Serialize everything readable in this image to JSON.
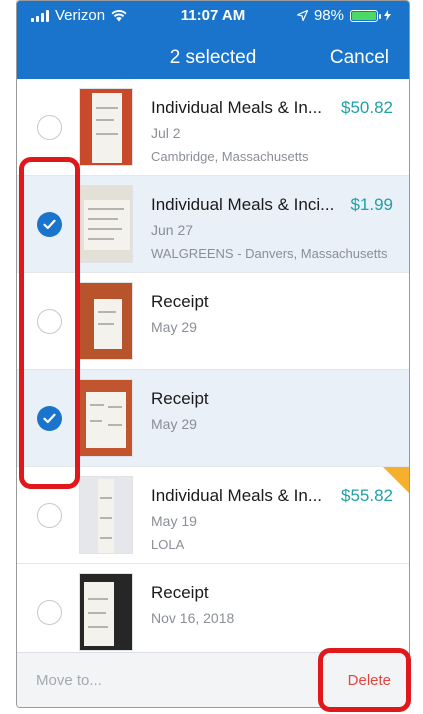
{
  "status_bar": {
    "carrier": "Verizon",
    "time": "11:07 AM",
    "battery": "98%"
  },
  "header": {
    "title": "2 selected",
    "cancel_label": "Cancel"
  },
  "receipts": [
    {
      "name": "Individual Meals & In...",
      "amount": "$50.82",
      "date": "Jul 2",
      "location": "Cambridge, Massachusetts",
      "selected": false
    },
    {
      "name": "Individual Meals & Inci...",
      "amount": "$1.99",
      "date": "Jun 27",
      "location": "WALGREENS - Danvers, Massachusetts",
      "selected": true
    },
    {
      "name": "Receipt",
      "amount": "",
      "date": "May 29",
      "location": "",
      "selected": false
    },
    {
      "name": "Receipt",
      "amount": "",
      "date": "May 29",
      "location": "",
      "selected": true
    },
    {
      "name": "Individual Meals & In...",
      "amount": "$55.82",
      "date": "May 19",
      "location": "LOLA",
      "selected": false,
      "flagged": true
    },
    {
      "name": "Receipt",
      "amount": "",
      "date": "Nov 16, 2018",
      "location": "",
      "selected": false
    }
  ],
  "footer": {
    "move_label": "Move to...",
    "delete_label": "Delete"
  },
  "colors": {
    "header_bg": "#1b74cb",
    "accent": "#1b74cb",
    "amount": "#21a0a6",
    "delete": "#e0473f",
    "highlight": "#e0181b",
    "flag": "#f5b02e"
  }
}
